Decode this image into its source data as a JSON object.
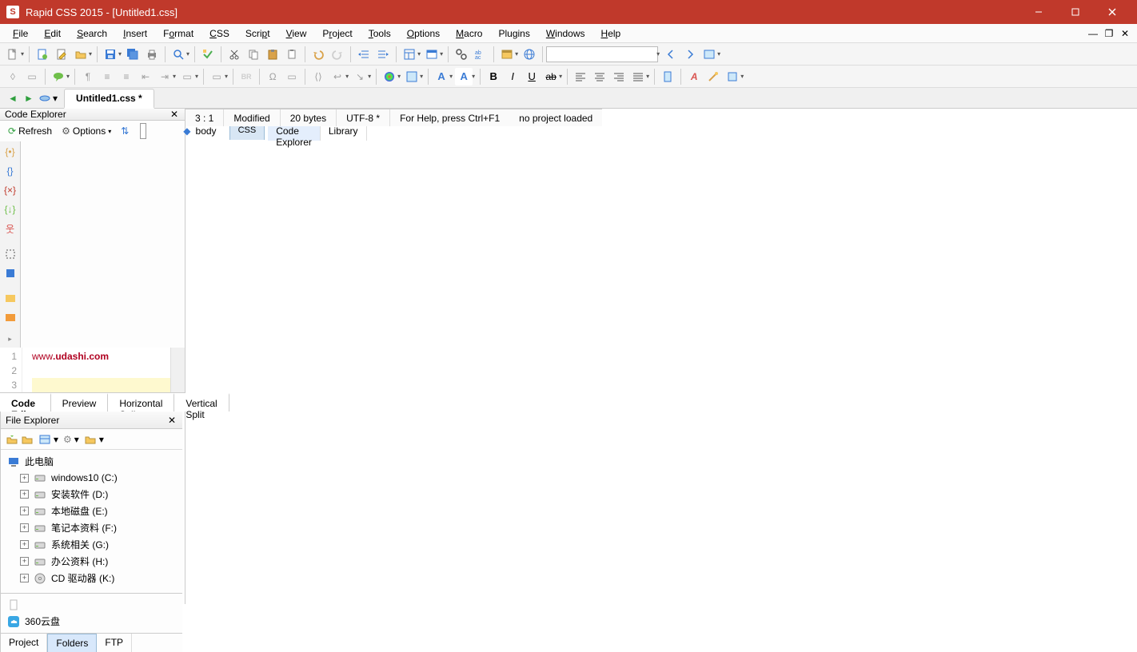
{
  "title": "Rapid CSS 2015 - [Untitled1.css]",
  "menu": [
    "File",
    "Edit",
    "Search",
    "Insert",
    "Format",
    "CSS",
    "Script",
    "View",
    "Project",
    "Tools",
    "Options",
    "Macro",
    "Plugins",
    "Windows",
    "Help"
  ],
  "doc_tab": "Untitled1.css *",
  "left": {
    "title": "Code Explorer",
    "refresh": "Refresh",
    "options": "Options",
    "tree_item": "body",
    "css_tab": "CSS",
    "bottom_tabs": [
      "Code Explorer",
      "Library"
    ]
  },
  "editor": {
    "lines": [
      "1",
      "2",
      "3"
    ],
    "line1": "www.udashi.com",
    "line1_bold": ".udashi.com",
    "line1_pre": "www",
    "tabs": [
      "Code Editor",
      "Preview",
      "Horizontal Split",
      "Vertical Split"
    ]
  },
  "right": {
    "title": "File Explorer",
    "root": "此电脑",
    "drives": [
      "windows10 (C:)",
      "安装软件 (D:)",
      "本地磁盘 (E:)",
      "笔记本资料 (F:)",
      "系统相关 (G:)",
      "办公资料 (H:)",
      "CD 驱动器 (K:)"
    ],
    "files": [
      "360云盘"
    ],
    "bottom_tabs": [
      "Project",
      "Folders",
      "FTP"
    ]
  },
  "status": {
    "pos": "3 : 1",
    "mod": "Modified",
    "bytes": "20 bytes",
    "enc": "UTF-8 *",
    "help": "For Help, press Ctrl+F1",
    "proj": "no project loaded"
  }
}
